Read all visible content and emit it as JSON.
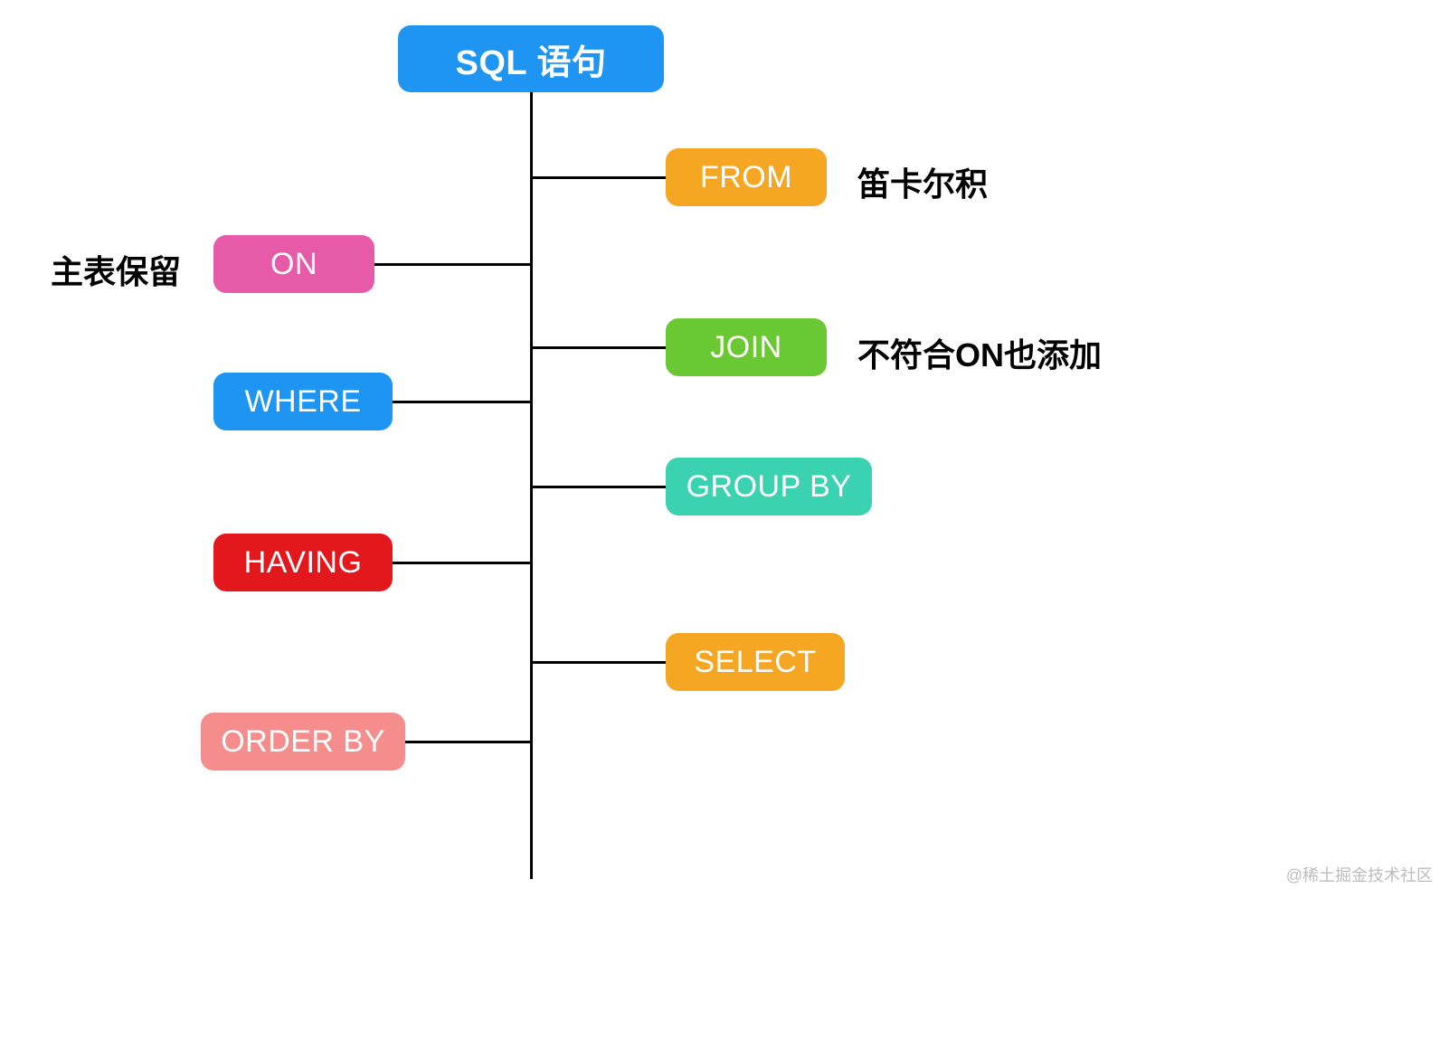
{
  "root": {
    "label": "SQL 语句",
    "color": "#1e95f2"
  },
  "nodes": {
    "from": {
      "label": "FROM",
      "color": "#f5a623",
      "annotation": "笛卡尔积"
    },
    "on": {
      "label": "ON",
      "color": "#e75aa8",
      "annotation": "主表保留"
    },
    "join": {
      "label": "JOIN",
      "color": "#6ac932",
      "annotation": "不符合ON也添加"
    },
    "where": {
      "label": "WHERE",
      "color": "#1e95f2"
    },
    "groupby": {
      "label": "GROUP BY",
      "color": "#3ad2b0"
    },
    "having": {
      "label": "HAVING",
      "color": "#e3181d"
    },
    "select": {
      "label": "SELECT",
      "color": "#f5a623"
    },
    "orderby": {
      "label": "ORDER BY",
      "color": "#f58d8d"
    }
  },
  "watermark": "@稀土掘金技术社区"
}
